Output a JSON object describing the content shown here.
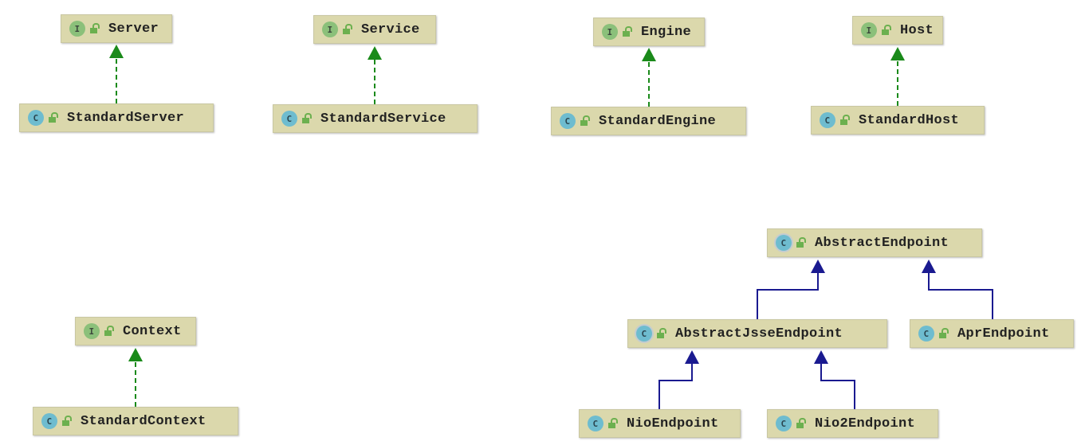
{
  "colors": {
    "realization": "#1a8a1a",
    "inheritance": "#1a1a90",
    "node_fill": "#dbd8ac"
  },
  "nodes": [
    {
      "id": "server",
      "name": "Server",
      "kind": "interface",
      "badge": "I"
    },
    {
      "id": "standard-server",
      "name": "StandardServer",
      "kind": "class",
      "badge": "C"
    },
    {
      "id": "service",
      "name": "Service",
      "kind": "interface",
      "badge": "I"
    },
    {
      "id": "standard-service",
      "name": "StandardService",
      "kind": "class",
      "badge": "C"
    },
    {
      "id": "engine",
      "name": "Engine",
      "kind": "interface",
      "badge": "I"
    },
    {
      "id": "standard-engine",
      "name": "StandardEngine",
      "kind": "class",
      "badge": "C"
    },
    {
      "id": "host",
      "name": "Host",
      "kind": "interface",
      "badge": "I"
    },
    {
      "id": "standard-host",
      "name": "StandardHost",
      "kind": "class",
      "badge": "C"
    },
    {
      "id": "context",
      "name": "Context",
      "kind": "interface",
      "badge": "I"
    },
    {
      "id": "standard-context",
      "name": "StandardContext",
      "kind": "class",
      "badge": "C"
    },
    {
      "id": "abstract-endpoint",
      "name": "AbstractEndpoint",
      "kind": "abstract",
      "badge": "C"
    },
    {
      "id": "abstract-jsse-endpoint",
      "name": "AbstractJsseEndpoint",
      "kind": "abstract",
      "badge": "C"
    },
    {
      "id": "apr-endpoint",
      "name": "AprEndpoint",
      "kind": "class",
      "badge": "C"
    },
    {
      "id": "nio-endpoint",
      "name": "NioEndpoint",
      "kind": "class",
      "badge": "C"
    },
    {
      "id": "nio2-endpoint",
      "name": "Nio2Endpoint",
      "kind": "class",
      "badge": "C"
    }
  ],
  "edges": [
    {
      "from": "StandardServer",
      "to": "Server",
      "type": "implements"
    },
    {
      "from": "StandardService",
      "to": "Service",
      "type": "implements"
    },
    {
      "from": "StandardEngine",
      "to": "Engine",
      "type": "implements"
    },
    {
      "from": "StandardHost",
      "to": "Host",
      "type": "implements"
    },
    {
      "from": "StandardContext",
      "to": "Context",
      "type": "implements"
    },
    {
      "from": "AbstractJsseEndpoint",
      "to": "AbstractEndpoint",
      "type": "extends"
    },
    {
      "from": "AprEndpoint",
      "to": "AbstractEndpoint",
      "type": "extends"
    },
    {
      "from": "NioEndpoint",
      "to": "AbstractJsseEndpoint",
      "type": "extends"
    },
    {
      "from": "Nio2Endpoint",
      "to": "AbstractJsseEndpoint",
      "type": "extends"
    }
  ]
}
